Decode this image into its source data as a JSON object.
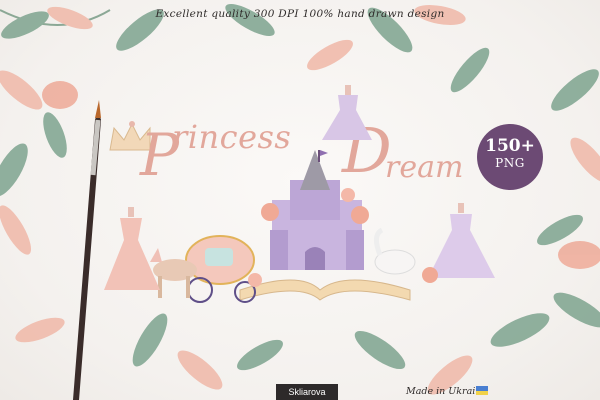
{
  "header": {
    "tagline": "Excellent quality 300 DPI 100% hand drawn design"
  },
  "title": {
    "word1": "rincess",
    "word2": "ream"
  },
  "badge": {
    "count": "150+",
    "unit": "PNG"
  },
  "footer": {
    "author": "Skliarova",
    "made_in": "Made in Ukraine"
  },
  "colors": {
    "badge_bg": "#6c4a74",
    "title_pink": "#e2a79b",
    "leaf_green": "#7ea48f",
    "leaf_peach": "#f0b8a8",
    "castle_lilac": "#c9b5df"
  },
  "icons": [
    "paint-brush-icon",
    "crown-icon",
    "castle-icon",
    "carriage-icon",
    "horse-icon",
    "dress-icon",
    "swan-icon",
    "book-icon",
    "ukraine-flag-icon"
  ]
}
